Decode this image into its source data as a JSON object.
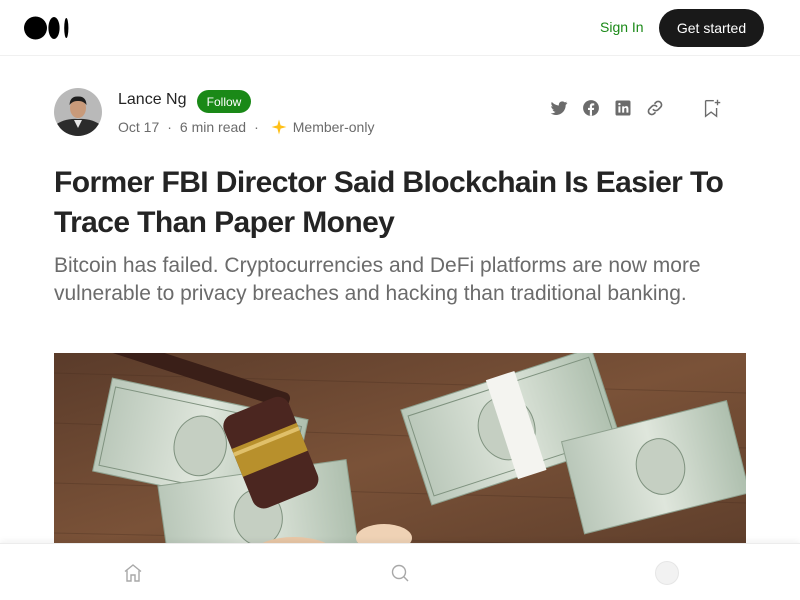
{
  "header": {
    "logo_icon": "medium-logo-icon",
    "sign_in_label": "Sign In",
    "get_started_label": "Get started"
  },
  "author": {
    "name": "Lance Ng",
    "follow_label": "Follow",
    "date": "Oct 17",
    "read_time": "6 min read",
    "member_label": "Member-only",
    "avatar_icon": "author-avatar",
    "member_icon": "star-icon"
  },
  "actions": {
    "icons": [
      "twitter-icon",
      "facebook-icon",
      "linkedin-icon",
      "link-icon",
      "bookmark-icon"
    ]
  },
  "article": {
    "title": "Former FBI Director Said Blockchain Is Easier To Trace Than Paper Money",
    "subtitle": "Bitcoin has failed. Cryptocurrencies and DeFi platforms are now more vulnerable to privacy breaches and hacking than traditional banking.",
    "hero_image": "gavel and stacks of 100 dollar bills on wooden table"
  },
  "bottom_nav": {
    "icons": [
      "home-icon",
      "search-icon",
      "profile-avatar"
    ]
  },
  "colors": {
    "accent_green": "#1a8917",
    "dark_button": "#191919",
    "text_primary": "#242424",
    "text_secondary": "#6b6b6b",
    "member_star": "#ffc017"
  }
}
